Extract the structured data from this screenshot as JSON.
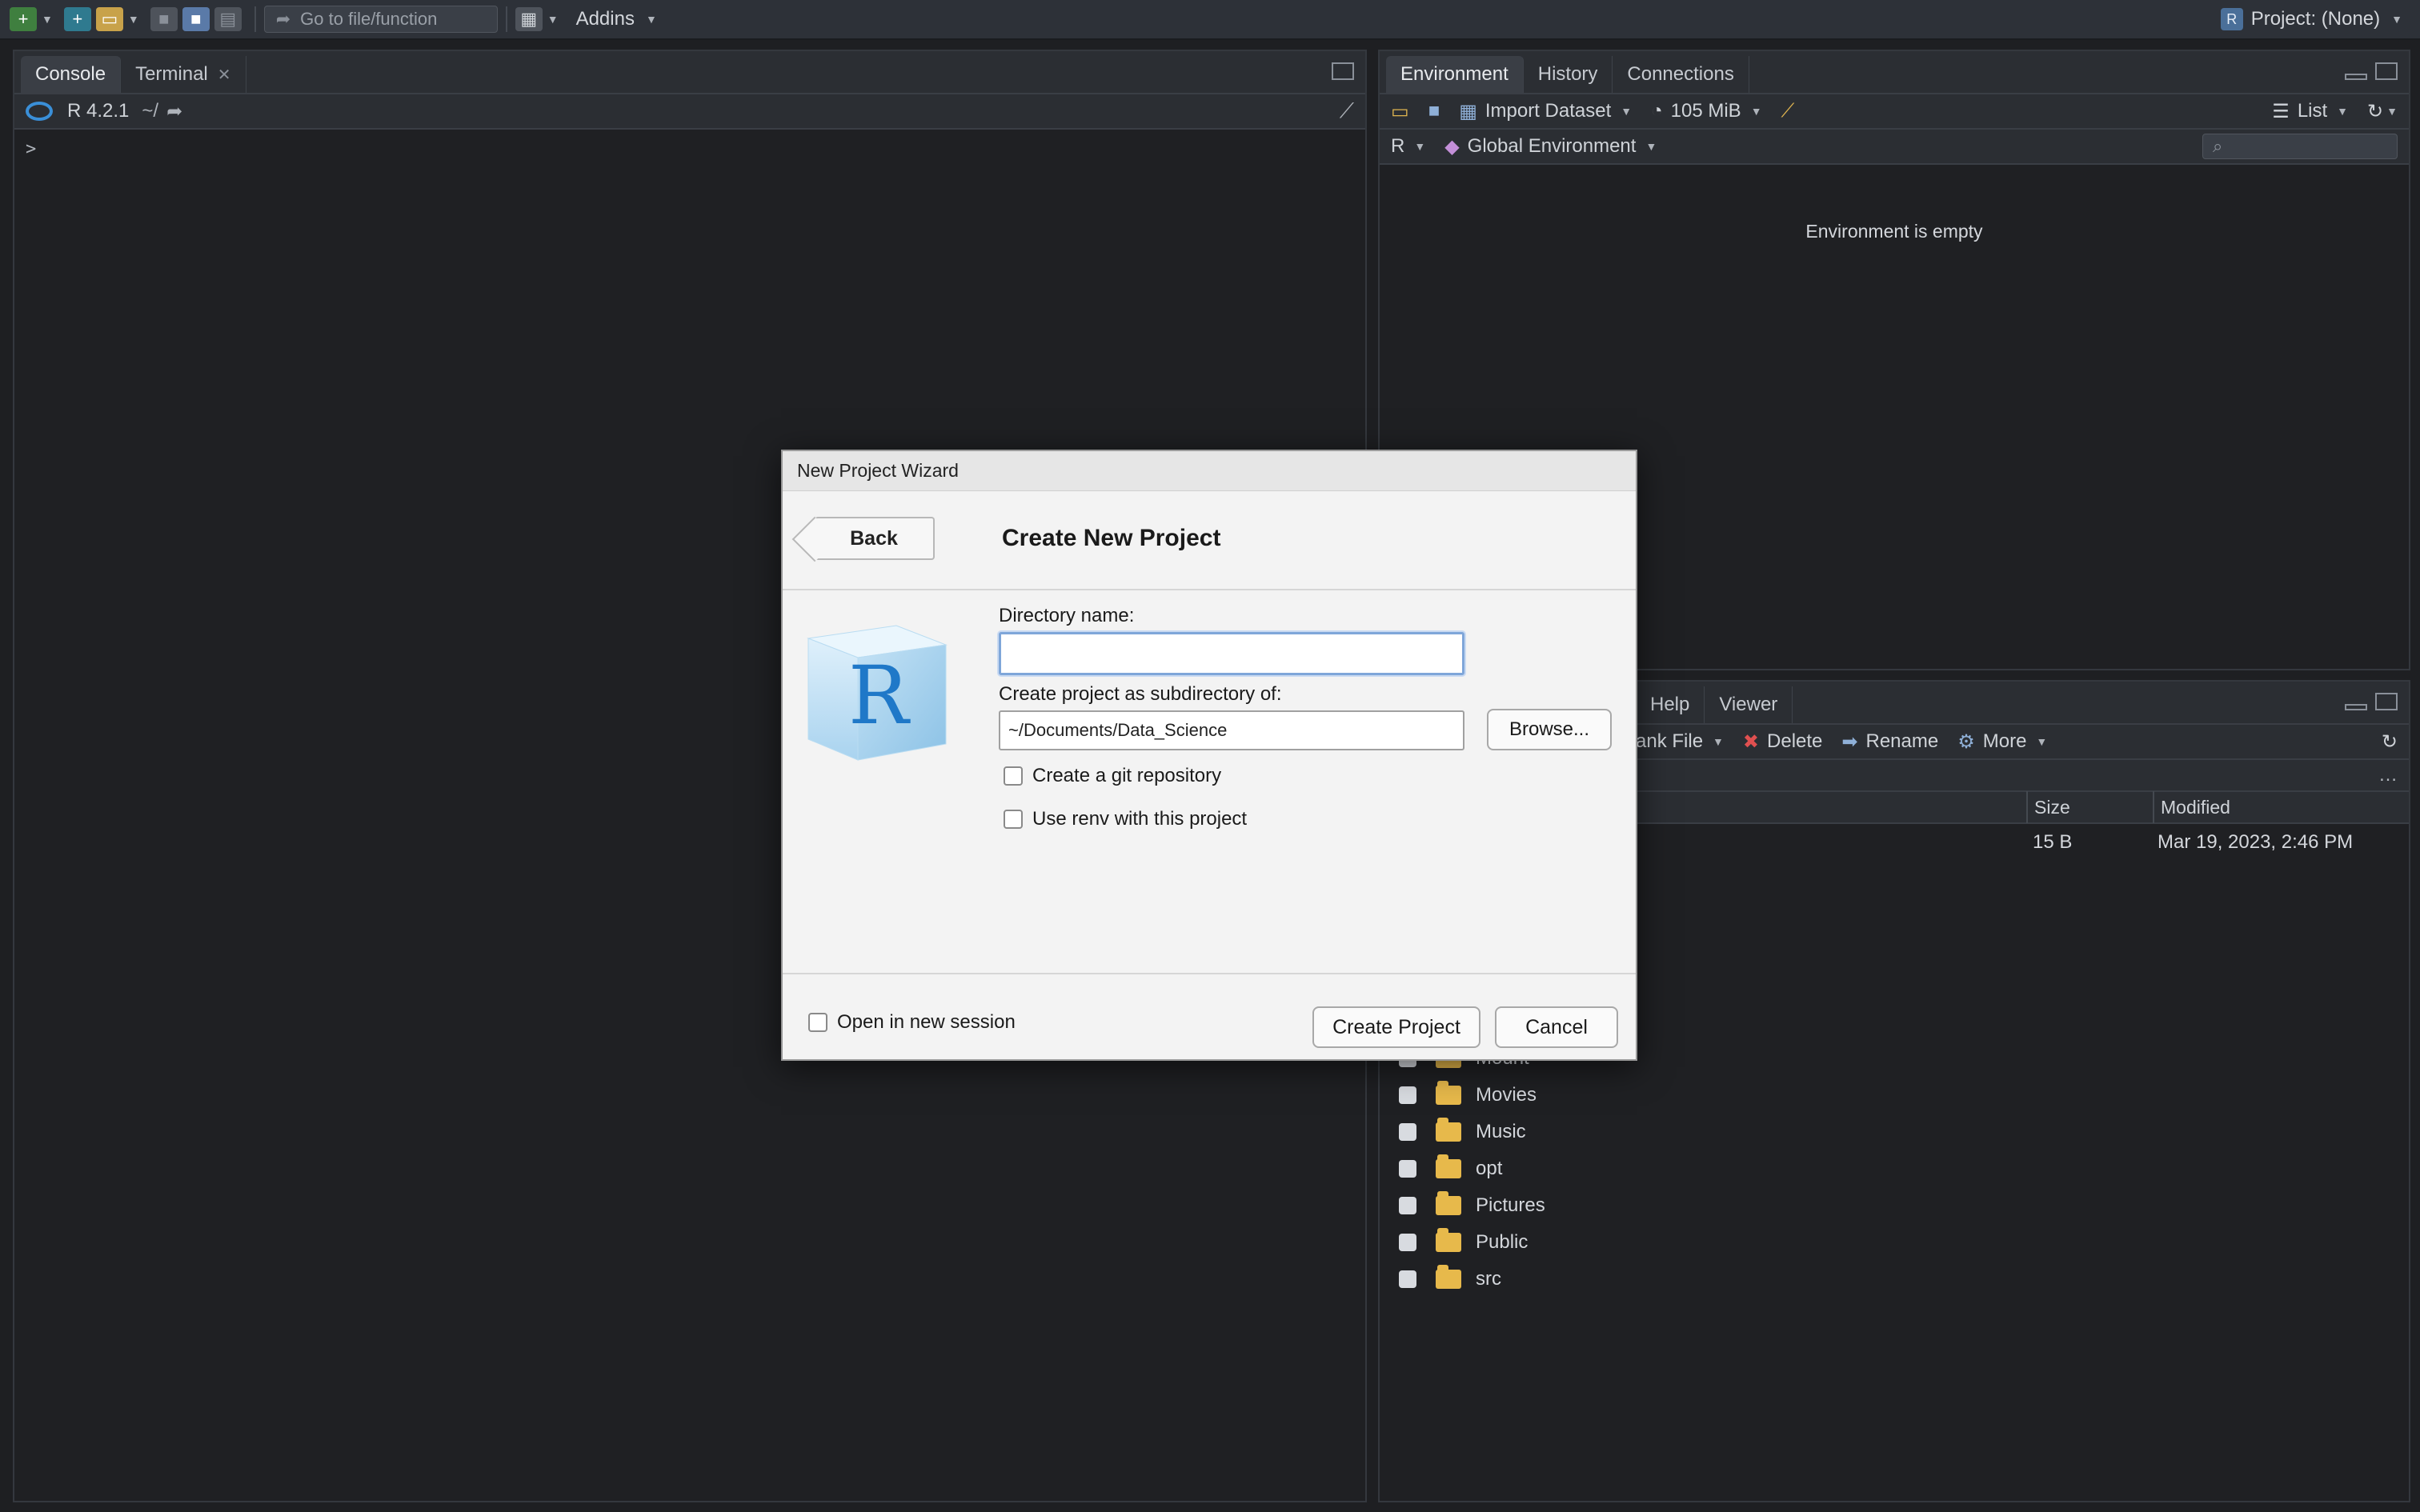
{
  "toolbar": {
    "goto_placeholder": "Go to file/function",
    "addins_label": "Addins",
    "project_label": "Project: (None)"
  },
  "console_pane": {
    "tabs": [
      {
        "label": "Console"
      },
      {
        "label": "Terminal"
      }
    ],
    "r_version": "R 4.2.1",
    "path": "~/",
    "prompt": ">"
  },
  "env_pane": {
    "tabs": [
      {
        "label": "Environment"
      },
      {
        "label": "History"
      },
      {
        "label": "Connections"
      }
    ],
    "import_label": "Import Dataset",
    "memory_label": "105 MiB",
    "list_label": "List",
    "lang_label": "R",
    "scope_label": "Global Environment",
    "empty_message": "Environment is empty"
  },
  "files_pane": {
    "tabs": [
      {
        "label": "Help"
      },
      {
        "label": "Viewer"
      }
    ],
    "blank_file_label": "ank File",
    "delete_label": "Delete",
    "rename_label": "Rename",
    "more_label": "More",
    "col_size": "Size",
    "col_modified": "Modified",
    "first_row": {
      "size": "15 B",
      "modified": "Mar 19, 2023, 2:46 PM"
    },
    "partial_row": "Mount",
    "rows": [
      {
        "name": "Movies"
      },
      {
        "name": "Music"
      },
      {
        "name": "opt"
      },
      {
        "name": "Pictures"
      },
      {
        "name": "Public"
      },
      {
        "name": "src"
      }
    ]
  },
  "dialog": {
    "window_title": "New Project Wizard",
    "back_label": "Back",
    "heading": "Create New Project",
    "dir_label": "Directory name:",
    "dir_value": "",
    "subdir_label": "Create project as subdirectory of:",
    "subdir_value": "~/Documents/Data_Science",
    "browse_label": "Browse...",
    "git_label": "Create a git repository",
    "renv_label": "Use renv with this project",
    "new_session_label": "Open in new session",
    "create_label": "Create Project",
    "cancel_label": "Cancel"
  }
}
